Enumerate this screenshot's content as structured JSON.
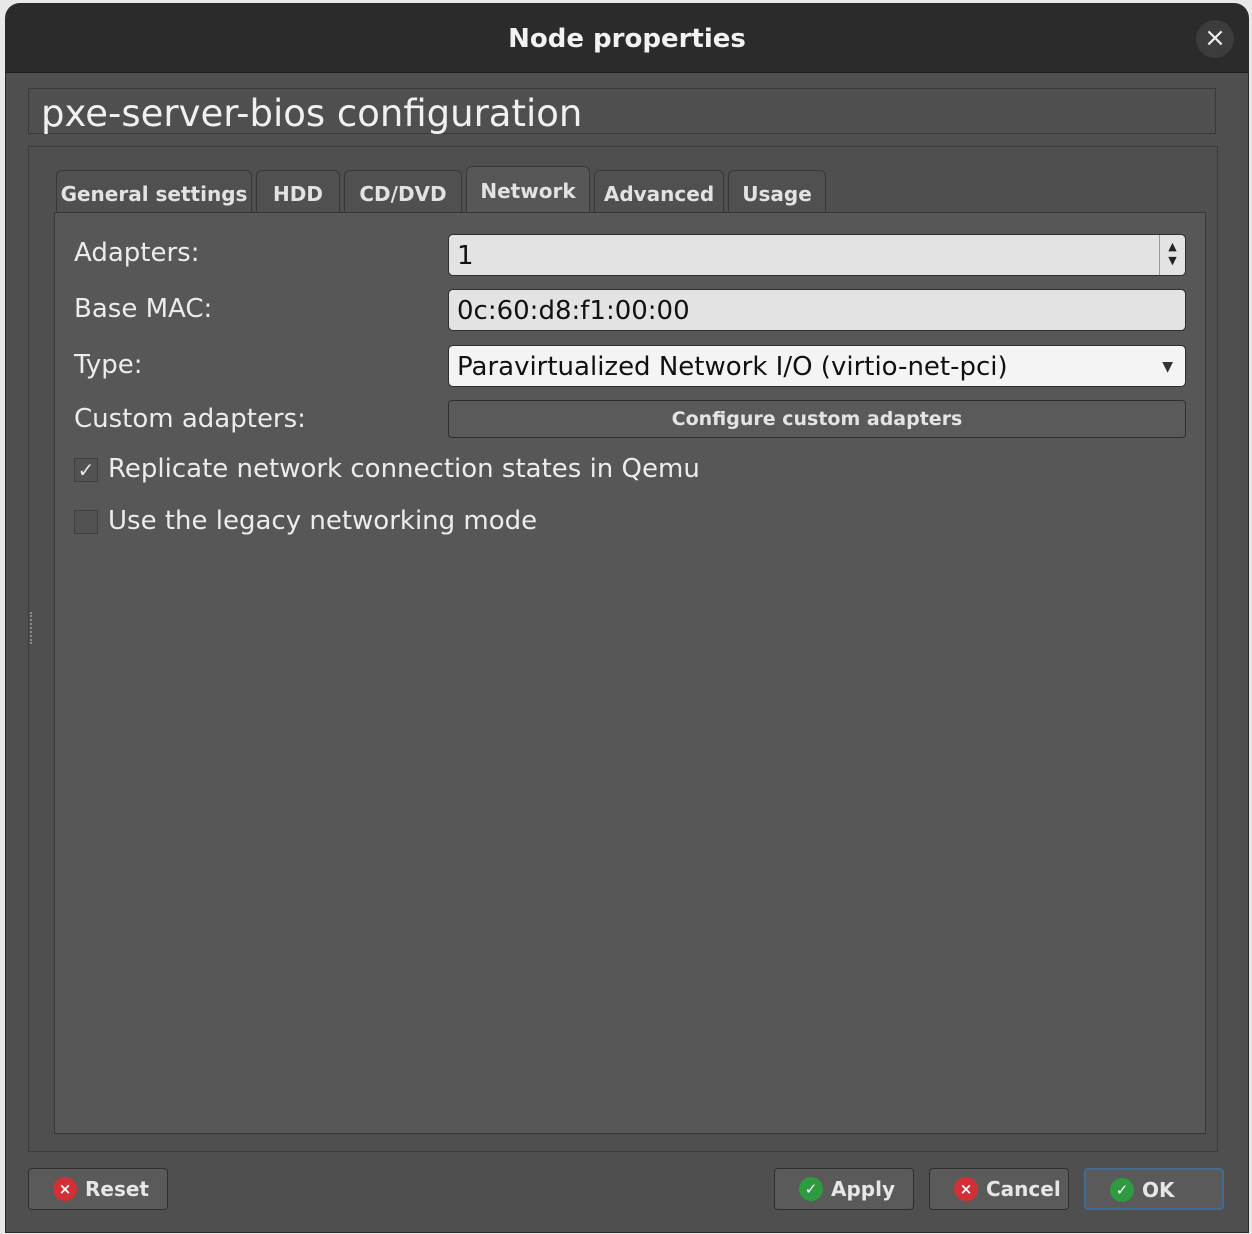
{
  "window": {
    "title": "Node properties",
    "close_icon": "×"
  },
  "config_title": "pxe-server-bios configuration",
  "tabs": [
    {
      "label": "General settings"
    },
    {
      "label": "HDD"
    },
    {
      "label": "CD/DVD"
    },
    {
      "label": "Network",
      "active": true
    },
    {
      "label": "Advanced"
    },
    {
      "label": "Usage"
    }
  ],
  "network": {
    "adapters_label": "Adapters:",
    "adapters_value": "1",
    "base_mac_label": "Base MAC:",
    "base_mac_value": "0c:60:d8:f1:00:00",
    "type_label": "Type:",
    "type_value": "Paravirtualized Network I/O (virtio-net-pci)",
    "custom_adapters_label": "Custom adapters:",
    "configure_button": "Configure custom adapters",
    "replicate_label": "Replicate network connection states in Qemu",
    "replicate_checked": true,
    "legacy_label": "Use the legacy networking mode",
    "legacy_checked": false
  },
  "buttons": {
    "reset": "Reset",
    "apply": "Apply",
    "cancel": "Cancel",
    "ok": "OK"
  },
  "colors": {
    "window_bg": "#4f4f4f",
    "titlebar_bg": "#2b2b2b",
    "ok_icon": "#2f9a3f",
    "cancel_icon": "#d32f36"
  }
}
